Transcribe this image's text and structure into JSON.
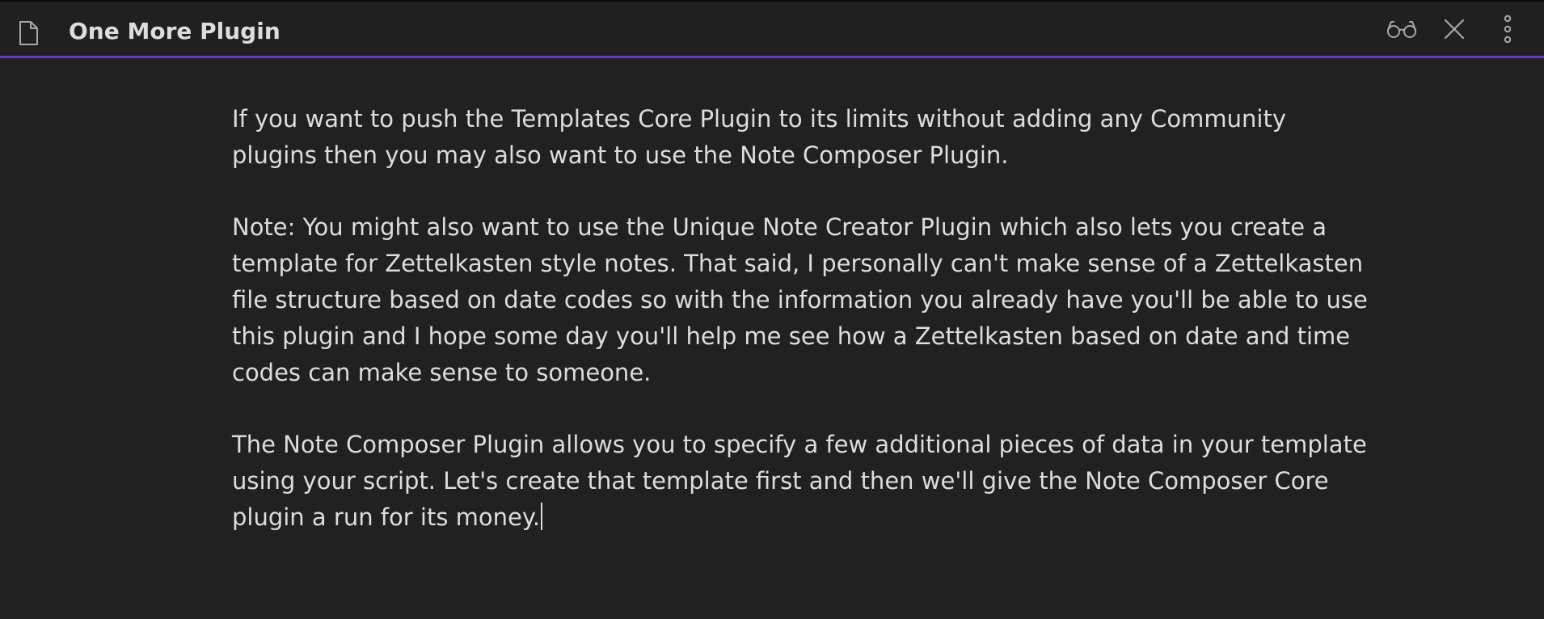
{
  "header": {
    "title": "One More Plugin",
    "icons": {
      "file": "file-icon",
      "preview": "glasses-icon",
      "close": "close-icon",
      "more": "more-vertical-icon"
    },
    "accent_color": "#5b42a8"
  },
  "content": {
    "paragraphs": [
      {
        "lines": [
          "If you want to push the Templates Core Plugin to its limits without adding any Community",
          "plugins then you may also want to use the Note Composer Plugin."
        ]
      },
      {
        "lines": [
          "Note: You might also want to use the Unique Note Creator Plugin which also lets you create a",
          "template for Zettelkasten style notes. That said, I personally can't make sense of a Zettelkasten",
          "file structure based on date codes so with the information you already have you'll be able to use",
          "this plugin and I hope some day you'll help me see how a Zettelkasten based on date and time",
          "codes can make sense to someone."
        ]
      },
      {
        "lines": [
          "The Note Composer Plugin allows you to specify a few additional pieces of data in your template",
          "using your script. Let's create that template first and then we'll give the Note Composer Core",
          "plugin a run for its money."
        ]
      }
    ]
  }
}
